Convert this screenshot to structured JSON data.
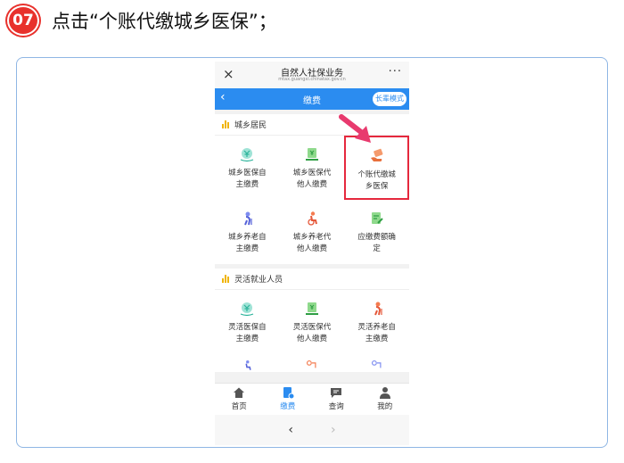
{
  "step": {
    "number": "07",
    "instruction": "点击“个账代缴城乡医保”；"
  },
  "window": {
    "close": "×",
    "title": "自然人社保业务",
    "url": "mtax.guangxi.chinatax.gov.cn",
    "more": "···"
  },
  "nav": {
    "back": "‹",
    "title": "缴费",
    "mode_button": "长辈模式"
  },
  "sections": [
    {
      "title": "城乡居民",
      "items": [
        {
          "label_1": "城乡医保自",
          "label_2": "主缴费"
        },
        {
          "label_1": "城乡医保代",
          "label_2": "他人缴费"
        },
        {
          "label_1": "个账代缴城",
          "label_2": "乡医保"
        },
        {
          "label_1": "城乡养老自",
          "label_2": "主缴费"
        },
        {
          "label_1": "城乡养老代",
          "label_2": "他人缴费"
        },
        {
          "label_1": "应缴费额确",
          "label_2": "定"
        }
      ]
    },
    {
      "title": "灵活就业人员",
      "items": [
        {
          "label_1": "灵活医保自",
          "label_2": "主缴费"
        },
        {
          "label_1": "灵活医保代",
          "label_2": "他人缴费"
        },
        {
          "label_1": "灵活养老自",
          "label_2": "主缴费"
        }
      ]
    }
  ],
  "tabs": [
    {
      "label": "首页",
      "icon": "home-icon"
    },
    {
      "label": "缴费",
      "icon": "payment-icon"
    },
    {
      "label": "查询",
      "icon": "message-icon"
    },
    {
      "label": "我的",
      "icon": "user-icon"
    }
  ],
  "browser_nav": {
    "back": "‹",
    "forward": "›"
  },
  "colors": {
    "accent": "#2b8cf0",
    "highlight": "#e5283d",
    "step_badge": "#e8312c"
  }
}
